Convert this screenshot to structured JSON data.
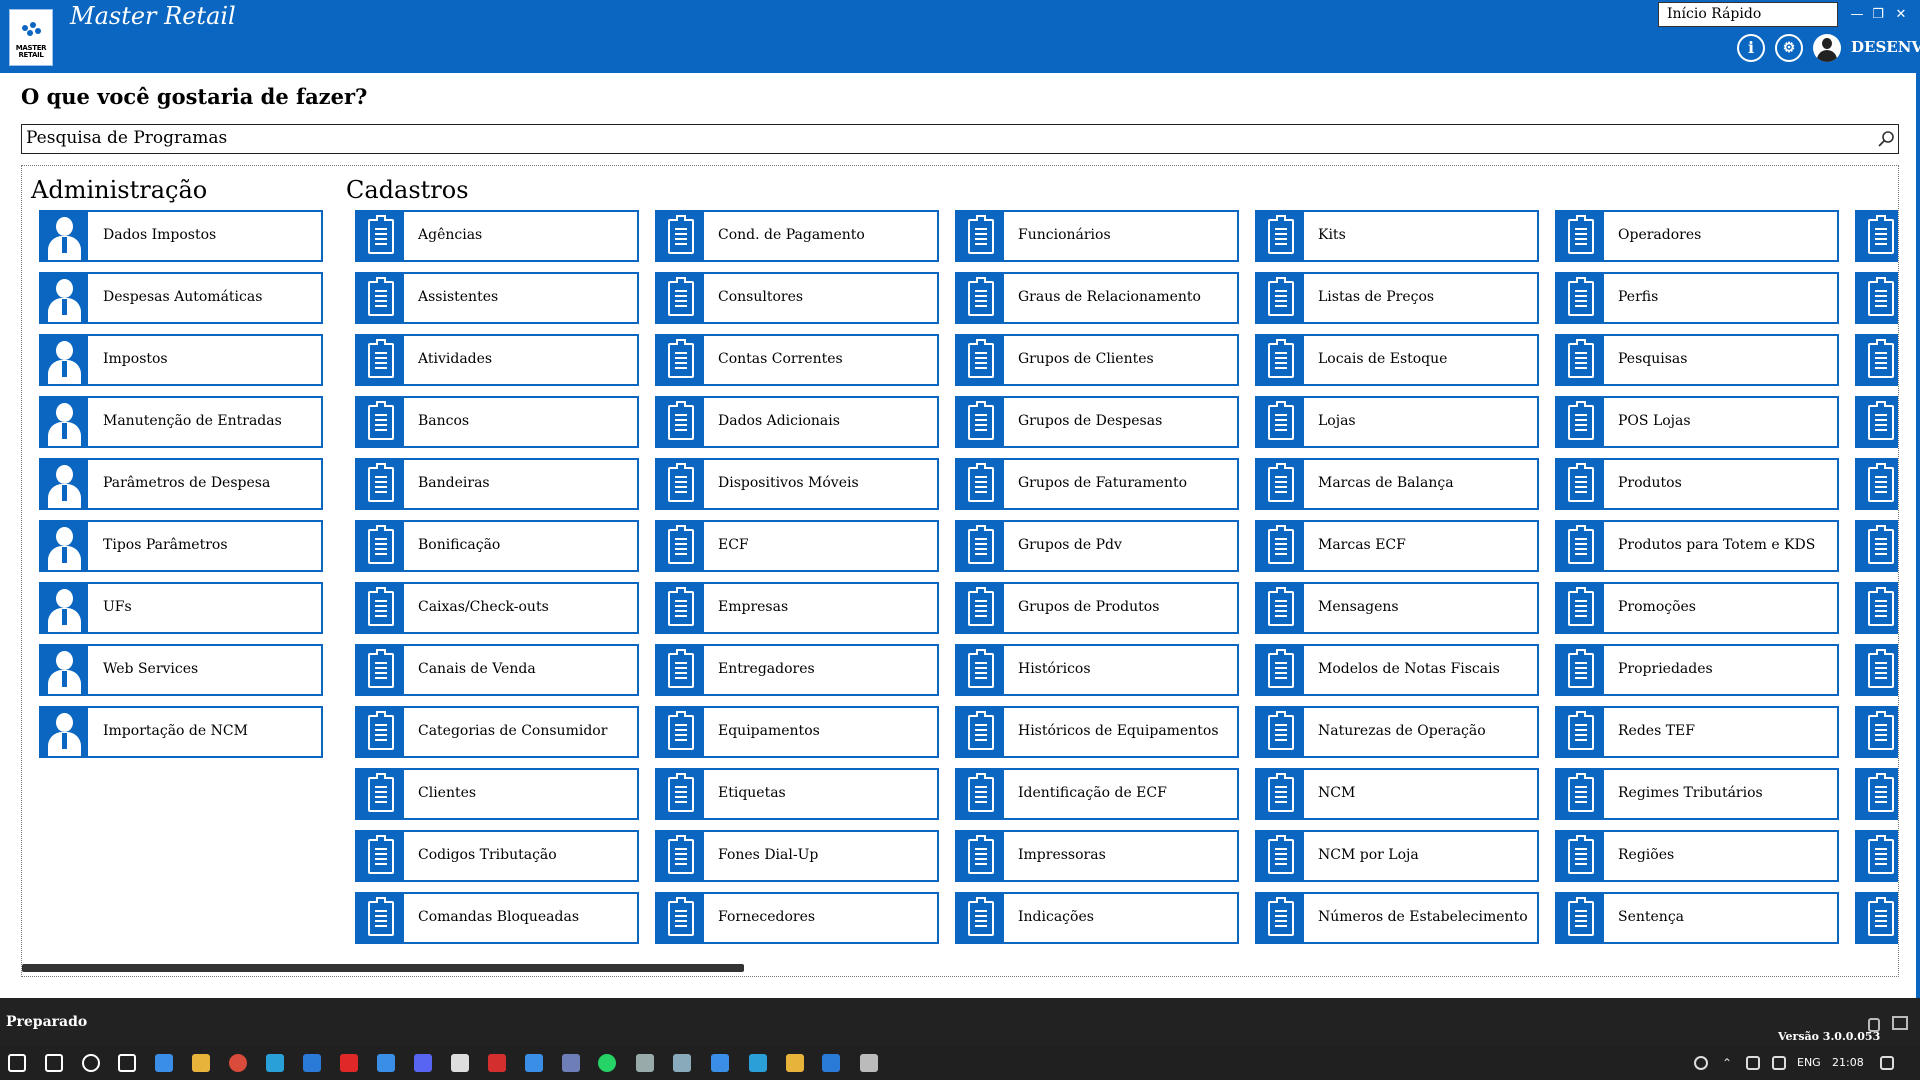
{
  "window": {
    "title": "Master Retail",
    "logo_text_1": "MASTER",
    "logo_text_2": "RETAIL",
    "quick_start": "Início Rápido",
    "user": "DESENV",
    "brand_color": "#0a66c0"
  },
  "main": {
    "question": "O que você gostaria de fazer?",
    "search_placeholder": "Pesquisa de Programas"
  },
  "sections": {
    "admin": {
      "title": "Administração",
      "items": [
        "Dados Impostos",
        "Despesas Automáticas",
        "Impostos",
        "Manutenção de Entradas",
        "Parâmetros de Despesa",
        "Tipos Parâmetros",
        "UFs",
        "Web Services",
        "Importação de NCM"
      ]
    },
    "cadastros": {
      "title": "Cadastros",
      "columns": [
        [
          "Agências",
          "Assistentes",
          "Atividades",
          "Bancos",
          "Bandeiras",
          "Bonificação",
          "Caixas/Check-outs",
          "Canais de Venda",
          "Categorias de Consumidor",
          "Clientes",
          "Codigos Tributação",
          "Comandas Bloqueadas"
        ],
        [
          "Cond. de Pagamento",
          "Consultores",
          "Contas Correntes",
          "Dados Adicionais",
          "Dispositivos Móveis",
          "ECF",
          "Empresas",
          "Entregadores",
          "Equipamentos",
          "Etiquetas",
          "Fones Dial-Up",
          "Fornecedores"
        ],
        [
          "Funcionários",
          "Graus de Relacionamento",
          "Grupos de Clientes",
          "Grupos de Despesas",
          "Grupos de Faturamento",
          "Grupos de Pdv",
          "Grupos de Produtos",
          "Históricos",
          "Históricos de Equipamentos",
          "Identificação de ECF",
          "Impressoras",
          "Indicações"
        ],
        [
          "Kits",
          "Listas de Preços",
          "Locais de Estoque",
          "Lojas",
          "Marcas de Balança",
          "Marcas ECF",
          "Mensagens",
          "Modelos de Notas Fiscais",
          "Naturezas de Operação",
          "NCM",
          "NCM por Loja",
          "Números de Estabelecimento"
        ],
        [
          "Operadores",
          "Perfis",
          "Pesquisas",
          "POS Lojas",
          "Produtos",
          "Produtos para Totem e KDS",
          "Promoções",
          "Propriedades",
          "Redes TEF",
          "Regimes Tributários",
          "Regiões",
          "Sentença"
        ],
        [
          "",
          "",
          "",
          "",
          "",
          "",
          "",
          "",
          "",
          "",
          "",
          ""
        ]
      ]
    }
  },
  "status": {
    "text": "Preparado",
    "version": "Versão 3.0.0.053"
  },
  "taskbar": {
    "lang": "ENG",
    "time": "21:08",
    "icons": [
      "windows-start-icon",
      "search-icon",
      "cortana-icon",
      "task-view-icon",
      "store-icon",
      "file-explorer-icon",
      "chrome-icon",
      "edge-icon",
      "vscode-icon",
      "opera-icon",
      "mail-icon",
      "discord-icon",
      "pointer-app-icon",
      "pdf-icon",
      "messenger-icon",
      "github-desktop-icon",
      "whatsapp-icon",
      "remote-desktop-icon",
      "tablet-app-icon",
      "master-retail-icon",
      "media-app-icon",
      "git-icon",
      "vscode-blue-icon",
      "misc-app-icon"
    ]
  }
}
